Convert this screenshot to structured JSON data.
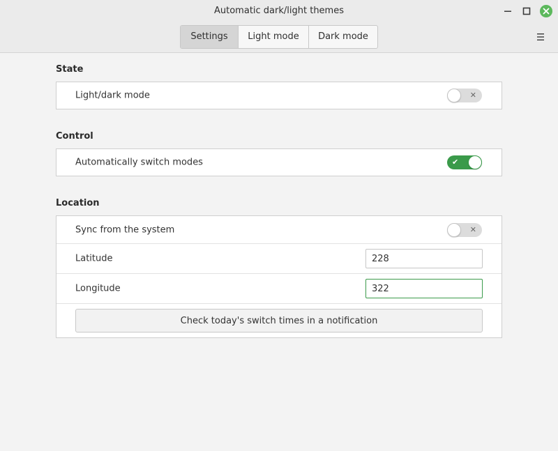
{
  "window": {
    "title": "Automatic dark/light themes"
  },
  "tabs": [
    {
      "label": "Settings",
      "active": true
    },
    {
      "label": "Light mode",
      "active": false
    },
    {
      "label": "Dark mode",
      "active": false
    }
  ],
  "sections": {
    "state": {
      "title": "State",
      "light_dark_label": "Light/dark mode",
      "light_dark_on": false
    },
    "control": {
      "title": "Control",
      "auto_switch_label": "Automatically switch modes",
      "auto_switch_on": true
    },
    "location": {
      "title": "Location",
      "sync_label": "Sync from the system",
      "sync_on": false,
      "latitude_label": "Latitude",
      "latitude_value": "228",
      "longitude_label": "Longitude",
      "longitude_value": "322",
      "check_button_label": "Check today's switch times in a notification"
    }
  },
  "icons": {
    "switch_off_mark": "✕",
    "switch_on_mark": "✔"
  },
  "colors": {
    "accent": "#3a9a4a",
    "close_button": "#5cb85c"
  }
}
